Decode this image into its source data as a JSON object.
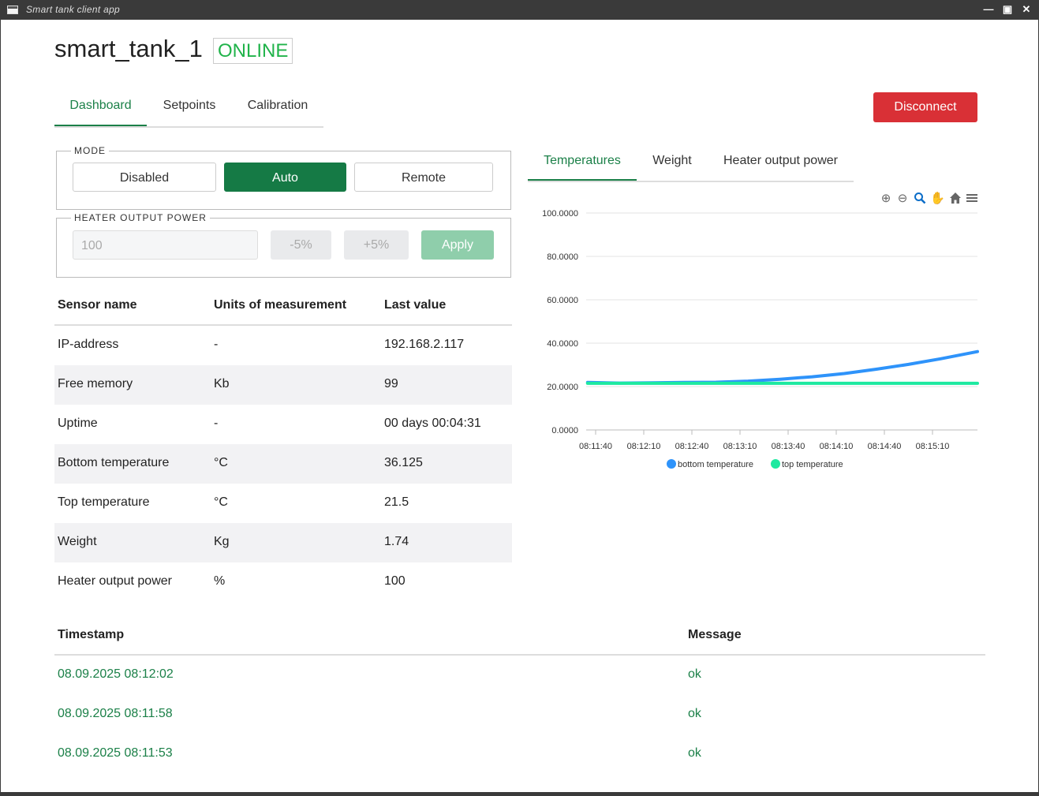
{
  "window": {
    "title": "Smart tank client app"
  },
  "header": {
    "device_name": "smart_tank_1",
    "status": "ONLINE"
  },
  "main_tabs": [
    {
      "label": "Dashboard",
      "active": true
    },
    {
      "label": "Setpoints",
      "active": false
    },
    {
      "label": "Calibration",
      "active": false
    }
  ],
  "disconnect_label": "Disconnect",
  "mode": {
    "legend": "MODE",
    "buttons": [
      {
        "label": "Disabled",
        "active": false
      },
      {
        "label": "Auto",
        "active": true
      },
      {
        "label": "Remote",
        "active": false
      }
    ]
  },
  "heater": {
    "legend": "HEATER OUTPUT POWER",
    "input_value": "100",
    "minus_label": "-5%",
    "plus_label": "+5%",
    "apply_label": "Apply"
  },
  "sensor_table": {
    "headers": [
      "Sensor name",
      "Units of measurement",
      "Last value"
    ],
    "rows": [
      [
        "IP-address",
        "-",
        "192.168.2.117"
      ],
      [
        "Free memory",
        "Kb",
        "99"
      ],
      [
        "Uptime",
        "-",
        "00 days 00:04:31"
      ],
      [
        "Bottom temperature",
        "°C",
        "36.125"
      ],
      [
        "Top temperature",
        "°C",
        "21.5"
      ],
      [
        "Weight",
        "Kg",
        "1.74"
      ],
      [
        "Heater output power",
        "%",
        "100"
      ]
    ]
  },
  "chart_tabs": [
    {
      "label": "Temperatures",
      "active": true
    },
    {
      "label": "Weight",
      "active": false
    },
    {
      "label": "Heater output power",
      "active": false
    }
  ],
  "chart_toolbar": [
    "zoom-in-icon",
    "zoom-out-icon",
    "selection-zoom-icon",
    "pan-hand-icon",
    "reset-home-icon",
    "menu-icon"
  ],
  "colors": {
    "accent": "#1b8048",
    "online": "#20b34a",
    "danger": "#d93036",
    "series_bottom": "#2e93fa",
    "series_top": "#1de9a0"
  },
  "chart_data": {
    "type": "line",
    "ylim": [
      0,
      100
    ],
    "yticks": [
      "100.0000",
      "80.0000",
      "60.0000",
      "40.0000",
      "20.0000",
      "0.0000"
    ],
    "xticks": [
      "08:11:40",
      "08:12:10",
      "08:12:40",
      "08:13:10",
      "08:13:40",
      "08:14:10",
      "08:14:40",
      "08:15:10"
    ],
    "grid": true,
    "legend": "bottom-center",
    "series": [
      {
        "name": "bottom temperature",
        "x": [
          "08:11:35",
          "08:11:55",
          "08:12:15",
          "08:12:35",
          "08:12:55",
          "08:13:15",
          "08:13:35",
          "08:13:55",
          "08:14:15",
          "08:14:35",
          "08:14:55",
          "08:15:15",
          "08:15:40"
        ],
        "values": [
          21.9,
          21.6,
          21.7,
          21.9,
          22.0,
          22.5,
          23.4,
          24.5,
          26.0,
          28.0,
          30.2,
          32.8,
          36.1
        ]
      },
      {
        "name": "top temperature",
        "x": [
          "08:11:35",
          "08:12:35",
          "08:13:35",
          "08:14:35",
          "08:15:40"
        ],
        "values": [
          21.5,
          21.5,
          21.5,
          21.5,
          21.5
        ]
      }
    ]
  },
  "log_table": {
    "headers": [
      "Timestamp",
      "Message"
    ],
    "rows": [
      [
        "08.09.2025 08:12:02",
        "ok"
      ],
      [
        "08.09.2025 08:11:58",
        "ok"
      ],
      [
        "08.09.2025 08:11:53",
        "ok"
      ]
    ]
  }
}
